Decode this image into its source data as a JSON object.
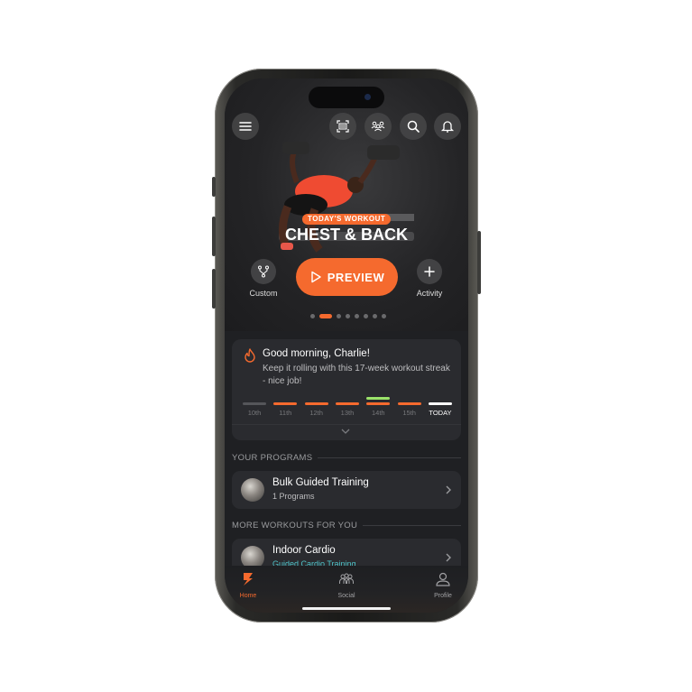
{
  "app": {
    "accent": "#f56a2e",
    "streak_highlight": "#9be36a"
  },
  "header": {
    "icons": [
      "menu-icon",
      "barcode-scan-icon",
      "group-icon",
      "search-icon",
      "bell-icon"
    ]
  },
  "hero": {
    "badge": "TODAY'S WORKOUT",
    "title": "CHEST & BACK",
    "preview_label": "PREVIEW",
    "left_action": {
      "label": "Custom",
      "icon": "fork-icon"
    },
    "right_action": {
      "label": "Activity",
      "icon": "plus-icon"
    },
    "carousel": {
      "total": 8,
      "active_index": 1
    }
  },
  "greeting": {
    "title": "Good morning, Charlie!",
    "subtitle": "Keep it rolling with this 17-week workout streak - nice job!",
    "streak": [
      {
        "label": "10th",
        "state": "missed"
      },
      {
        "label": "11th",
        "state": "done"
      },
      {
        "label": "12th",
        "state": "done"
      },
      {
        "label": "13th",
        "state": "done"
      },
      {
        "label": "14th",
        "state": "done",
        "extra": true
      },
      {
        "label": "15th",
        "state": "done"
      },
      {
        "label": "TODAY",
        "state": "today"
      }
    ]
  },
  "programs": {
    "section_label": "YOUR PROGRAMS",
    "items": [
      {
        "title": "Bulk Guided Training",
        "subtitle": "1 Programs"
      }
    ]
  },
  "more_workouts": {
    "section_label": "MORE WORKOUTS FOR YOU",
    "items": [
      {
        "title": "Indoor Cardio",
        "subtitle": "Guided Cardio Training"
      }
    ]
  },
  "tabbar": {
    "tabs": [
      {
        "label": "Home",
        "active": true
      },
      {
        "label": "Social",
        "active": false
      },
      {
        "label": "Profile",
        "active": false
      }
    ]
  }
}
